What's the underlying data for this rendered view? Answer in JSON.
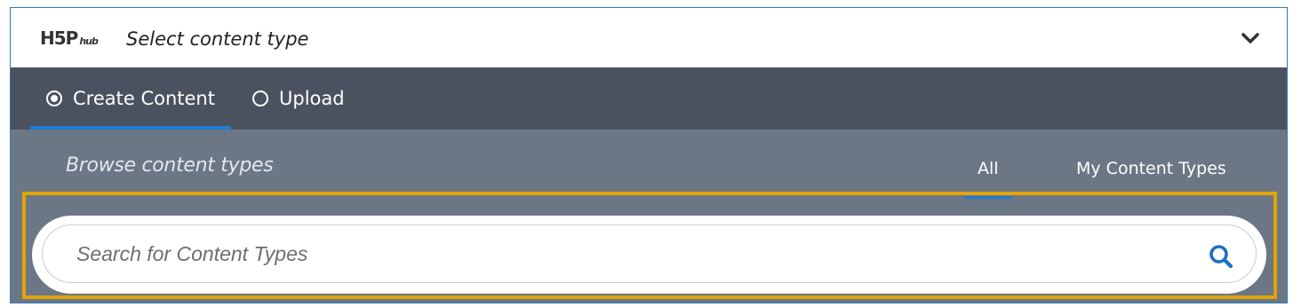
{
  "header": {
    "logo_main": "H5P",
    "logo_sub": "hub",
    "title": "Select content type",
    "toggle_icon": "chevron-down-icon"
  },
  "tabs": [
    {
      "label": "Create Content",
      "selected": true
    },
    {
      "label": "Upload",
      "selected": false
    }
  ],
  "browse": {
    "title": "Browse content types",
    "filters": [
      {
        "label": "All",
        "active": true
      },
      {
        "label": "My Content Types",
        "active": false
      }
    ]
  },
  "search": {
    "placeholder": "Search for Content Types",
    "value": "",
    "icon": "search-icon"
  },
  "colors": {
    "tab_bar": "#4a5260",
    "browse_panel": "#6b7785",
    "accent": "#1f7bd3",
    "highlight": "#e2a406",
    "search_icon": "#1a6fc4"
  }
}
